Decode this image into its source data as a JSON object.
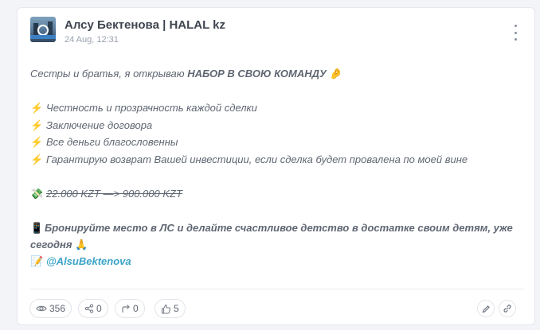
{
  "post": {
    "channel_name": "Алсу Бектенова | HALAL kz",
    "date": "24 Aug, 12:31",
    "intro_text": "Сестры и братья, я открываю ",
    "intro_bold": "НАБОР В СВОЮ КОМАНДУ",
    "intro_emoji": "🤌",
    "bullet_icon": "⚡",
    "bullets": [
      "Честность и прозрачность каждой сделки",
      "Заключение договора",
      "Все деньги благословенны",
      "Гарантирую возврат Вашей инвестиции, если сделка будет провалена по моей вине"
    ],
    "money_icon": "💸",
    "money_text": "22.000 KZT —> 900.000 KZT",
    "booking_icon": "📱",
    "booking_line1": "Бронируйте место в ЛС и делайте счастливое детство в достатке своим детям, уже",
    "booking_line2": "сегодня",
    "pray_emoji": "🙏",
    "contact_icon": "📝",
    "contact_mention": "@AlsuBektenova"
  },
  "stats": {
    "views": "356",
    "shares": "0",
    "forwards": "0",
    "reactions": "5"
  },
  "icons": {
    "views": "eye-icon",
    "shares": "share-icon",
    "forwards": "forward-arrow-icon",
    "reactions": "thumbs-up-icon",
    "edit": "pencil-icon",
    "link": "link-icon",
    "menu": "more-vertical-icon"
  },
  "colors": {
    "mention": "#3aa3c7",
    "text": "#5f6672",
    "bolt": "#f08a3c"
  }
}
